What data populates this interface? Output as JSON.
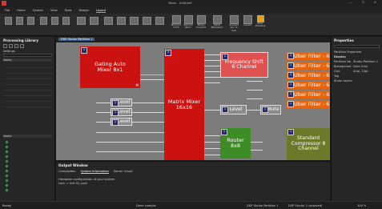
{
  "title_bar": {
    "title": "Tesira - Untitled*"
  },
  "menu": [
    "File",
    "Home",
    "System",
    "View",
    "Tools",
    "Design",
    "Layout"
  ],
  "ribbon": {
    "buttons": [
      {
        "label": "Bring to Front"
      },
      {
        "label": "Send to Back"
      },
      {
        "label": "Bring Forward"
      },
      {
        "label": "Send Backward"
      },
      {
        "label": "Convert Sel. to Sub"
      },
      {
        "label": "Layers"
      },
      {
        "label": "Print Drawing"
      }
    ]
  },
  "library": {
    "title": "Processing Library",
    "search_label": "Settings",
    "tree_header": "Name",
    "tree_header2": "Name"
  },
  "tab": {
    "label": "DSP Studio Partition 1"
  },
  "blocks": {
    "gating": "Gating Auto Mixer 8x1",
    "matrix": "Matrix Mixer 16x16",
    "freq": "Frequency Shift 6 Channel",
    "router": "Router 8x8",
    "compressor": "Standard Compressor 8 Channel",
    "level": "Level",
    "mute": "Mute",
    "uber": "Uber Filter - 6",
    "m_label": "M"
  },
  "properties": {
    "title": "Properties",
    "section": "Partition Properties",
    "rows": [
      {
        "k": "Partition Na",
        "v": "Studio Partition 1"
      },
      {
        "k": "Background",
        "v": "Dark Gray"
      },
      {
        "k": "Grid",
        "v": "Arial, 10pt"
      },
      {
        "k": "Tag",
        "v": ""
      },
      {
        "k": "Show Layers",
        "v": ""
      }
    ],
    "group": "Display"
  },
  "output": {
    "title": "Output Window",
    "tabs": [
      "Compilation",
      "System Information",
      "Server Count"
    ],
    "lines": [
      "Hardware configuration of your system",
      "Lock = Unit ID_Lock"
    ]
  },
  "status": {
    "left": "Ready",
    "center": "Done compile",
    "partition": "DSP Studio Partition 1",
    "right": "DSP Studio 1 (unsaved)",
    "zoom": "100 %"
  },
  "colors": {
    "red": "#cc1111",
    "pink": "#e05252",
    "orange": "#e8630a",
    "green": "#3d8c26",
    "olive": "#6b7a28",
    "gray": "#8a8a8a",
    "canvas": "#7c7c7c"
  }
}
